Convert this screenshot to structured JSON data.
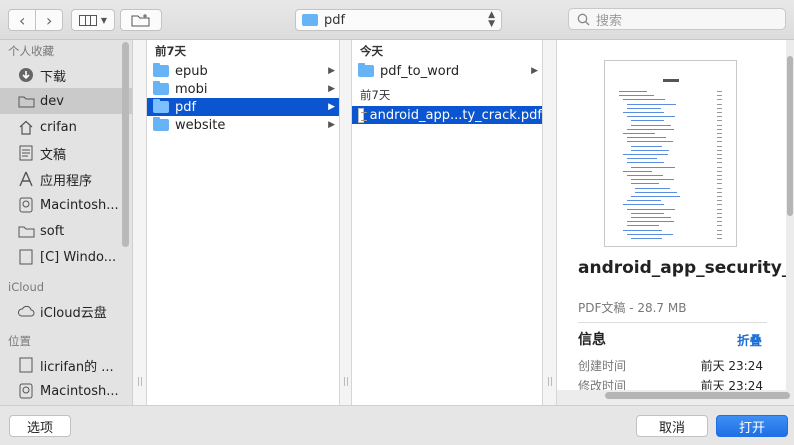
{
  "toolbar": {
    "location_label": "pdf",
    "search_placeholder": "搜索"
  },
  "sidebar": {
    "sections": [
      {
        "title": "个人收藏"
      },
      {
        "title": "iCloud"
      },
      {
        "title": "位置"
      }
    ],
    "favorites": [
      {
        "label": "下载",
        "icon": "download-icon"
      },
      {
        "label": "dev",
        "icon": "folder-icon",
        "selected": true
      },
      {
        "label": "crifan",
        "icon": "home-icon"
      },
      {
        "label": "文稿",
        "icon": "document-icon"
      },
      {
        "label": "应用程序",
        "icon": "applications-icon"
      },
      {
        "label": "Macintosh...",
        "icon": "disk-icon"
      },
      {
        "label": "soft",
        "icon": "folder-icon"
      },
      {
        "label": "[C] Windo...",
        "icon": "document-icon"
      }
    ],
    "icloud": [
      {
        "label": "iCloud云盘",
        "icon": "cloud-icon"
      }
    ],
    "locations": [
      {
        "label": "licrifan的 ...",
        "icon": "computer-icon"
      },
      {
        "label": "Macintosh...",
        "icon": "disk-icon"
      }
    ]
  },
  "column1": {
    "header": "前7天",
    "items": [
      {
        "label": "epub"
      },
      {
        "label": "mobi"
      },
      {
        "label": "pdf",
        "selected": true
      },
      {
        "label": "website"
      }
    ]
  },
  "column2": {
    "header_today": "今天",
    "today_items": [
      {
        "label": "pdf_to_word"
      }
    ],
    "header_week": "前7天",
    "week_items": [
      {
        "label": "android_app...ty_crack.pdf",
        "selected": true
      }
    ]
  },
  "preview": {
    "file_name": "android_app_security_crack.pdf",
    "meta": "PDF文稿 - 28.7 MB",
    "info_label": "信息",
    "fold_label": "折叠",
    "created_label": "创建时间",
    "created_value": "前天 23:24",
    "modified_label": "修改时间",
    "modified_value": "前天 23:24"
  },
  "bottom": {
    "options_label": "选项",
    "cancel_label": "取消",
    "open_label": "打开"
  },
  "colors": {
    "accent": "#0b56d0",
    "folder": "#66b3f5",
    "link": "#1a6cd8"
  }
}
